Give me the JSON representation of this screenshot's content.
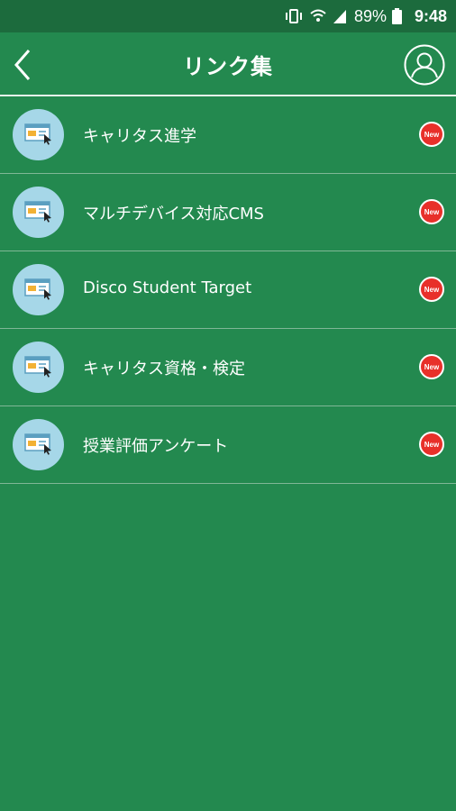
{
  "status_bar": {
    "battery": "89%",
    "time": "9:48"
  },
  "header": {
    "title": "リンク集"
  },
  "links": [
    {
      "label": "キャリタス進学",
      "badge": "New"
    },
    {
      "label": "マルチデバイス対応CMS",
      "badge": "New"
    },
    {
      "label": "Disco Student Target",
      "badge": "New"
    },
    {
      "label": "キャリタス資格・検定",
      "badge": "New"
    },
    {
      "label": "授業評価アンケート",
      "badge": "New"
    }
  ],
  "colors": {
    "background": "#23894f",
    "status_bar": "#1c6b3d",
    "icon_circle": "#a6d7e8",
    "badge": "#e8302a"
  },
  "icons": {
    "back": "chevron-left-icon",
    "profile": "user-circle-icon",
    "link_item": "browser-cursor-icon"
  }
}
